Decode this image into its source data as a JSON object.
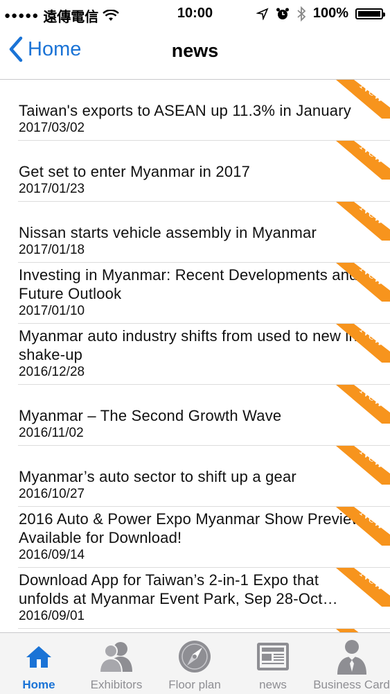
{
  "status_bar": {
    "carrier": "遠傳電信",
    "time": "10:00",
    "battery": "100%",
    "battery_level": 1.0
  },
  "nav": {
    "back_label": "Home",
    "title": "news"
  },
  "news": {
    "badge": "New",
    "items": [
      {
        "title": "Taiwan's exports to ASEAN up 11.3% in January",
        "date": "2017/03/02"
      },
      {
        "title": "Get set to enter Myanmar in 2017",
        "date": "2017/01/23"
      },
      {
        "title": "Nissan starts vehicle assembly in Myanmar",
        "date": "2017/01/18"
      },
      {
        "title": "Investing in Myanmar: Recent Developments and Future Outlook",
        "date": "2017/01/10"
      },
      {
        "title": "Myanmar auto industry shifts from used to new in shake-up",
        "date": "2016/12/28"
      },
      {
        "title": "Myanmar – The Second Growth Wave",
        "date": "2016/11/02"
      },
      {
        "title": "Myanmar’s auto sector to shift up a gear",
        "date": "2016/10/27"
      },
      {
        "title": "2016 Auto & Power Expo Myanmar Show Preview Available for Download!",
        "date": "2016/09/14"
      },
      {
        "title": "Download App for Taiwan’s 2-in-1 Expo that unfolds at Myanmar Event Park, Sep 28-Oct…",
        "date": "2016/09/01"
      }
    ]
  },
  "tabs": [
    {
      "label": "Home",
      "icon": "home-icon",
      "active": true
    },
    {
      "label": "Exhibitors",
      "icon": "people-icon",
      "active": false
    },
    {
      "label": "Floor plan",
      "icon": "compass-icon",
      "active": false
    },
    {
      "label": "news",
      "icon": "newspaper-icon",
      "active": false
    },
    {
      "label": "Business Card",
      "icon": "businessman-icon",
      "active": false
    }
  ],
  "colors": {
    "accent": "#1a73d6",
    "ribbon": "#f7941d",
    "tab_inactive": "#8e8e93"
  }
}
